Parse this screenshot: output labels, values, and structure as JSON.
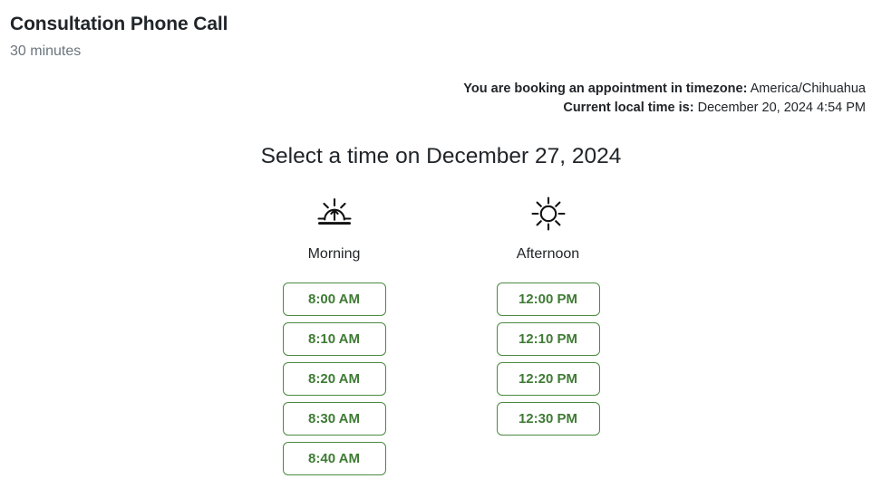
{
  "event": {
    "title": "Consultation Phone Call",
    "duration": "30 minutes"
  },
  "timezone_info": {
    "booking_label": "You are booking an appointment in timezone:",
    "booking_value": "America/Chihuahua",
    "current_time_label": "Current local time is:",
    "current_time_value": "December 20, 2024 4:54 PM"
  },
  "select_time": {
    "heading": "Select a time on December 27, 2024"
  },
  "columns": [
    {
      "key": "morning",
      "icon": "sunrise-icon",
      "label": "Morning",
      "slots": [
        "8:00 AM",
        "8:10 AM",
        "8:20 AM",
        "8:30 AM",
        "8:40 AM"
      ]
    },
    {
      "key": "afternoon",
      "icon": "sun-icon",
      "label": "Afternoon",
      "slots": [
        "12:00 PM",
        "12:10 PM",
        "12:20 PM",
        "12:30 PM"
      ]
    }
  ],
  "colors": {
    "slot_border": "#4a8b3f",
    "slot_text": "#3f7b34",
    "muted_text": "#6c757d",
    "body_text": "#212529",
    "background": "#ffffff"
  }
}
